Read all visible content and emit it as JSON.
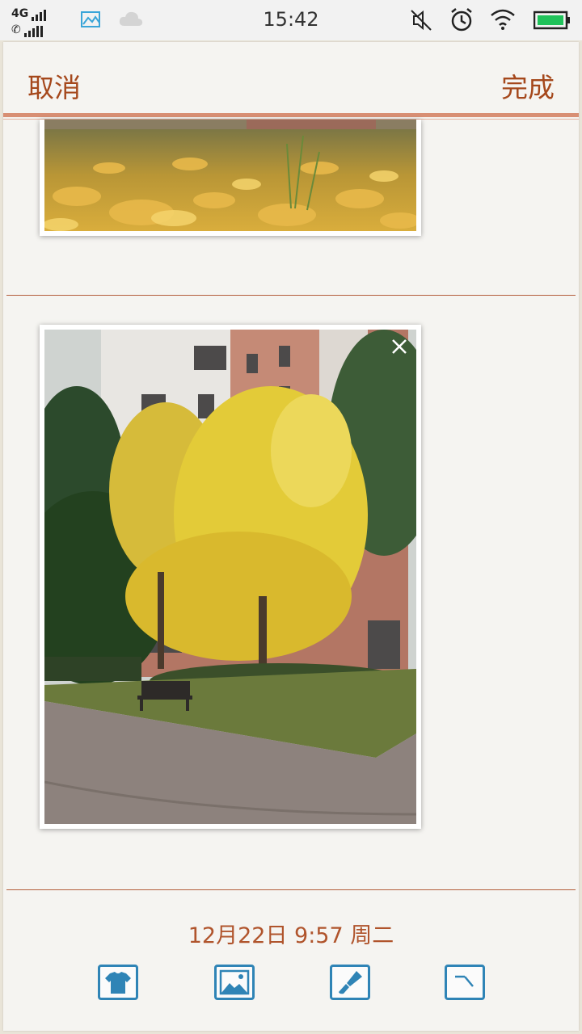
{
  "status_bar": {
    "network": "4G",
    "time": "15:42",
    "icons": [
      "signal-icon",
      "call-signal-icon",
      "screenshot-icon",
      "cloud-icon",
      "mute-icon",
      "alarm-icon",
      "wifi-icon",
      "battery-icon"
    ],
    "battery_level": 1.0
  },
  "header": {
    "cancel_label": "取消",
    "done_label": "完成"
  },
  "note": {
    "date_text": "12月22日 9:57 周二",
    "photos": [
      {
        "subject": "ginkgo leaves on grass"
      },
      {
        "subject": "yellow ginkgo tree in front of building"
      }
    ]
  },
  "toolbar": {
    "items": [
      "shirt-icon",
      "image-icon",
      "brush-icon",
      "clock-icon"
    ]
  },
  "colors": {
    "accent": "#a5481c",
    "rule": "#b35e3c",
    "tool_blue": "#2f84b6",
    "paper": "#f5f4f1"
  }
}
